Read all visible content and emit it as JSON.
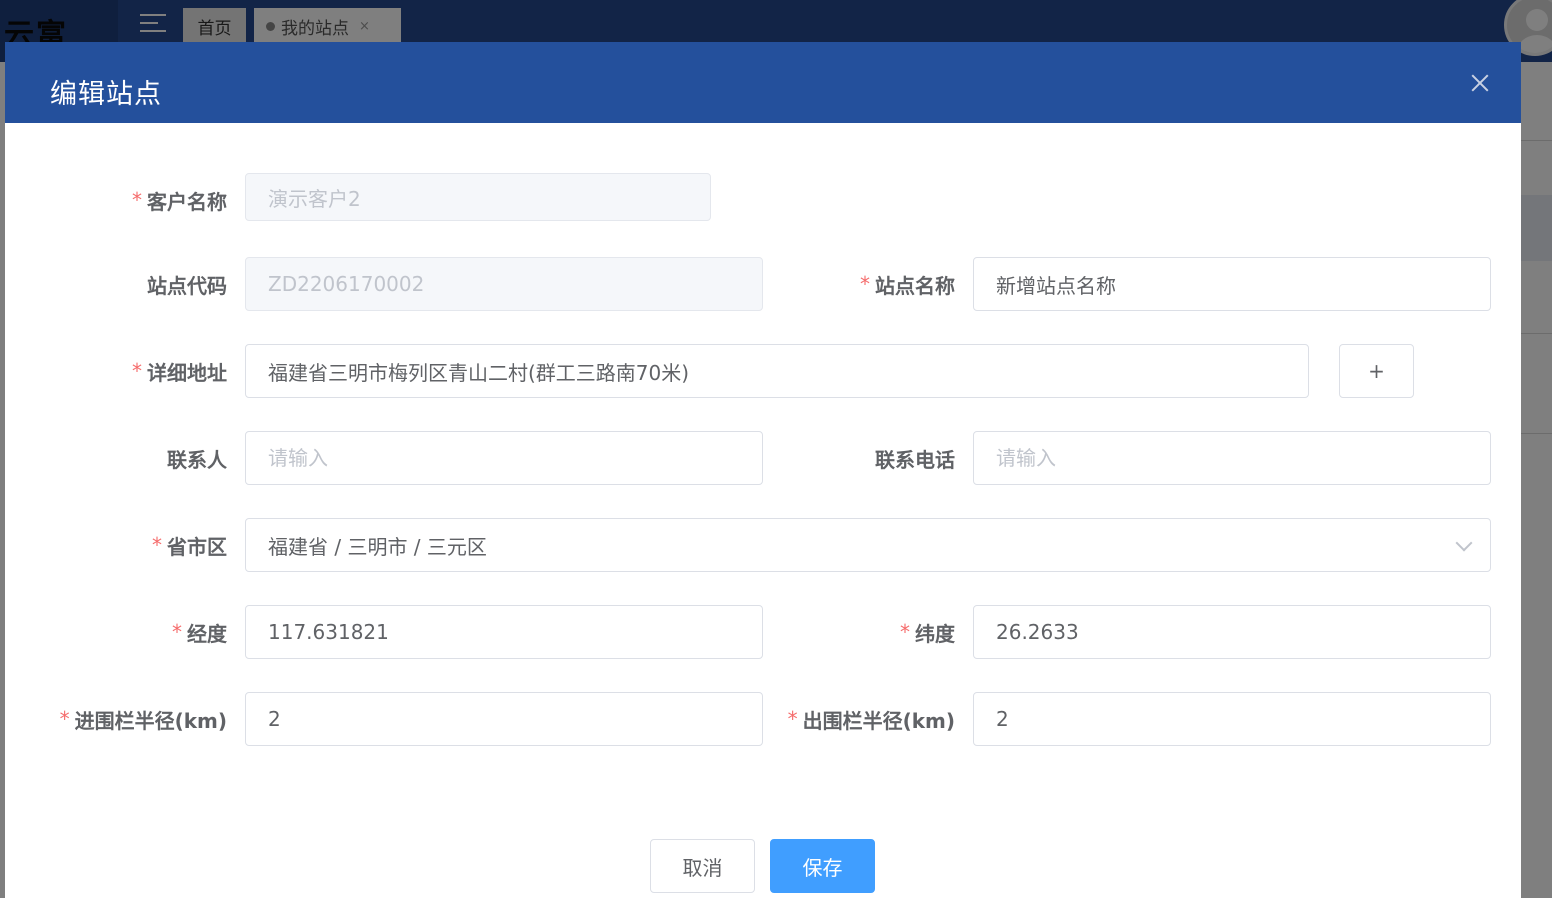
{
  "app": {
    "logo_text": "云富",
    "tabs": [
      {
        "label": "首页"
      },
      {
        "label": "我的站点",
        "close": "×"
      }
    ]
  },
  "dialog": {
    "title": "编辑站点",
    "fields": {
      "customer_name": {
        "label": "客户名称",
        "required": "*",
        "value": "演示客户2"
      },
      "site_code": {
        "label": "站点代码",
        "value": "ZD2206170002"
      },
      "site_name": {
        "label": "站点名称",
        "required": "*",
        "value": "新增站点名称"
      },
      "address": {
        "label": "详细地址",
        "required": "*",
        "value": "福建省三明市梅列区青山二村(群工三路南70米)",
        "add_label": "+"
      },
      "contact": {
        "label": "联系人",
        "placeholder": "请输入"
      },
      "phone": {
        "label": "联系电话",
        "placeholder": "请输入"
      },
      "region": {
        "label": "省市区",
        "required": "*",
        "value": "福建省 / 三明市 / 三元区"
      },
      "longitude": {
        "label": "经度",
        "required": "*",
        "value": "117.631821"
      },
      "latitude": {
        "label": "纬度",
        "required": "*",
        "value": "26.2633"
      },
      "fence_in": {
        "label": "进围栏半径(km)",
        "required": "*",
        "value": "2"
      },
      "fence_out": {
        "label": "出围栏半径(km)",
        "required": "*",
        "value": "2"
      }
    },
    "buttons": {
      "cancel": "取消",
      "save": "保存"
    }
  }
}
